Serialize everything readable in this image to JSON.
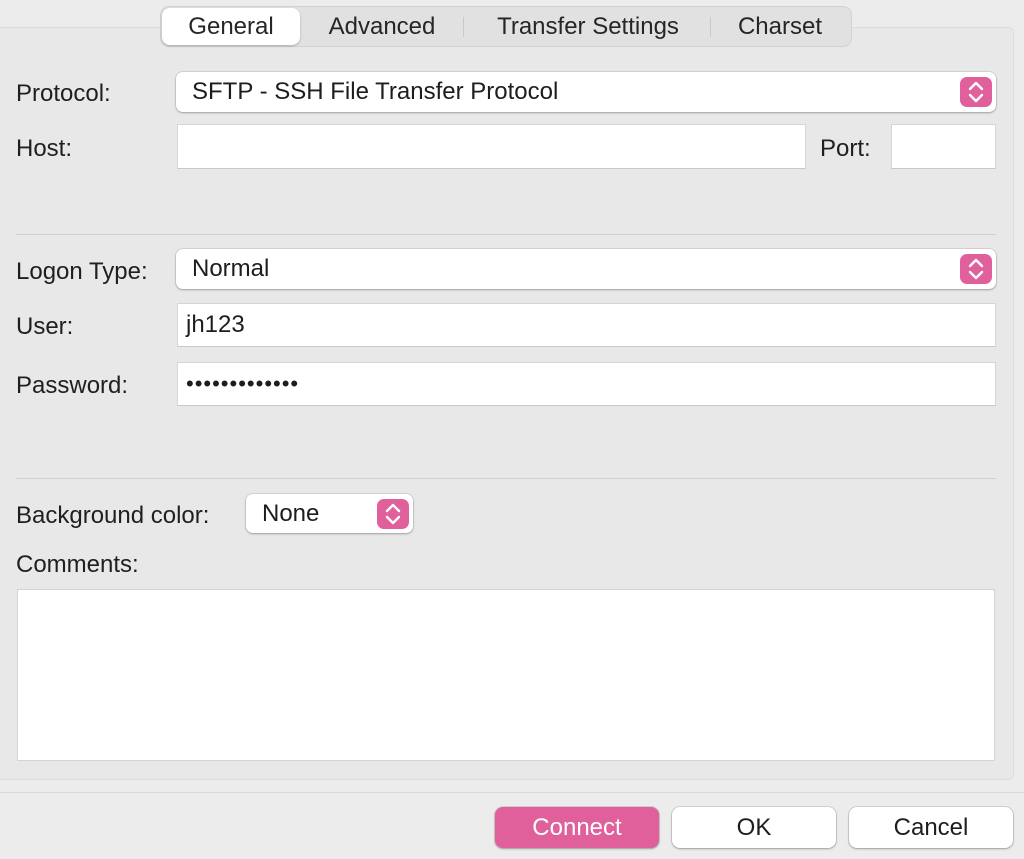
{
  "tabs": [
    {
      "label": "General",
      "active": true
    },
    {
      "label": "Advanced",
      "active": false
    },
    {
      "label": "Transfer Settings",
      "active": false
    },
    {
      "label": "Charset",
      "active": false
    }
  ],
  "general": {
    "protocol_label": "Protocol:",
    "protocol_value": "SFTP - SSH File Transfer Protocol",
    "host_label": "Host:",
    "host_value": "",
    "port_label": "Port:",
    "port_value": "",
    "logon_type_label": "Logon Type:",
    "logon_type_value": "Normal",
    "user_label": "User:",
    "user_value": "jh123",
    "password_label": "Password:",
    "password_value": "•••••••••••••",
    "background_color_label": "Background color:",
    "background_color_value": "None",
    "comments_label": "Comments:",
    "comments_value": ""
  },
  "buttons": {
    "connect_label": "Connect",
    "ok_label": "OK",
    "cancel_label": "Cancel"
  },
  "colors": {
    "accent": "#e0609b",
    "background": "#ececec",
    "panel": "#e8e8e8"
  },
  "icons": {
    "popup_stepper": "chevron-up-down-icon"
  }
}
